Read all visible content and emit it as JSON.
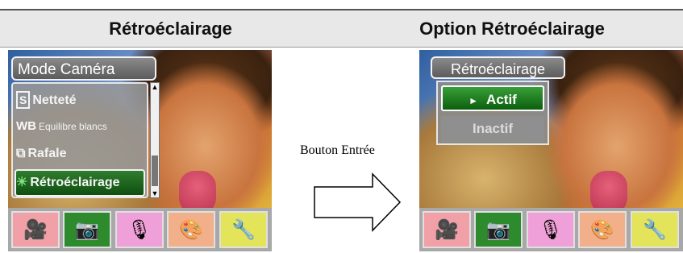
{
  "header": {
    "left_title": "Rétroéclairage",
    "right_title": "Option Rétroéclairage"
  },
  "left_screen": {
    "menu_title": "Mode Caméra",
    "items": [
      {
        "icon": "S",
        "label": "Netteté"
      },
      {
        "icon": "WB",
        "label": "Equilibre blancs"
      },
      {
        "icon": "burst-icon",
        "label": "Rafale"
      },
      {
        "icon": "backlight-icon",
        "label": "Rétroéclairage",
        "selected": true
      }
    ]
  },
  "right_screen": {
    "menu_title": "Rétroéclairage",
    "options": [
      {
        "label": "Actif",
        "selected": true,
        "marker": "►"
      },
      {
        "label": "Inactif",
        "selected": false
      }
    ]
  },
  "arrow_label": "Bouton Entrée",
  "modes": [
    "video-camera-icon",
    "camera-icon",
    "microphone-icon",
    "palette-icon",
    "tools-icon"
  ],
  "colors": {
    "selected_green": "#1f6e20",
    "menu_gray": "#8c8c8c"
  }
}
